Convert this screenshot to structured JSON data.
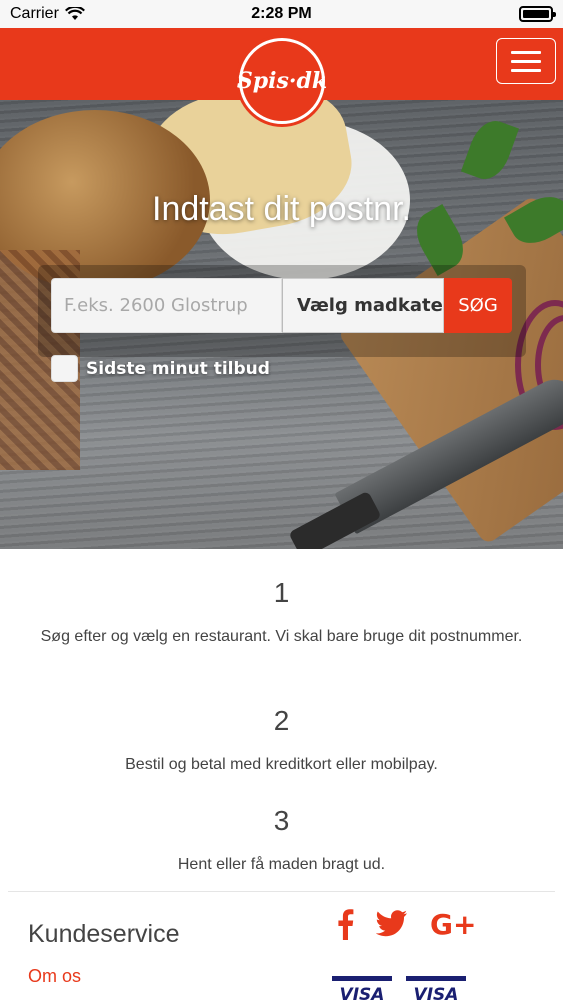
{
  "status_bar": {
    "carrier": "Carrier",
    "time": "2:28 PM"
  },
  "header": {
    "logo_text": "Spis·dk",
    "brand_color": "#e8391b"
  },
  "hero": {
    "title": "Indtast dit postnr.",
    "search_placeholder": "F.eks. 2600 Glostrup",
    "category_label": "Vælg madkategori",
    "search_button": "SØG",
    "offer_label": "Sidste minut tilbud"
  },
  "steps": [
    {
      "number": "1",
      "text": "Søg efter og vælg en restaurant. Vi skal bare bruge dit postnummer."
    },
    {
      "number": "2",
      "text": "Bestil og betal med kreditkort eller mobilpay."
    },
    {
      "number": "3",
      "text": "Hent eller få maden bragt ud."
    }
  ],
  "footer": {
    "title": "Kundeservice",
    "links": [
      "Om os"
    ],
    "social_icons": [
      "facebook-icon",
      "twitter-icon",
      "google-plus-icon"
    ],
    "payment_cards": [
      "VISA",
      "VISA"
    ]
  }
}
